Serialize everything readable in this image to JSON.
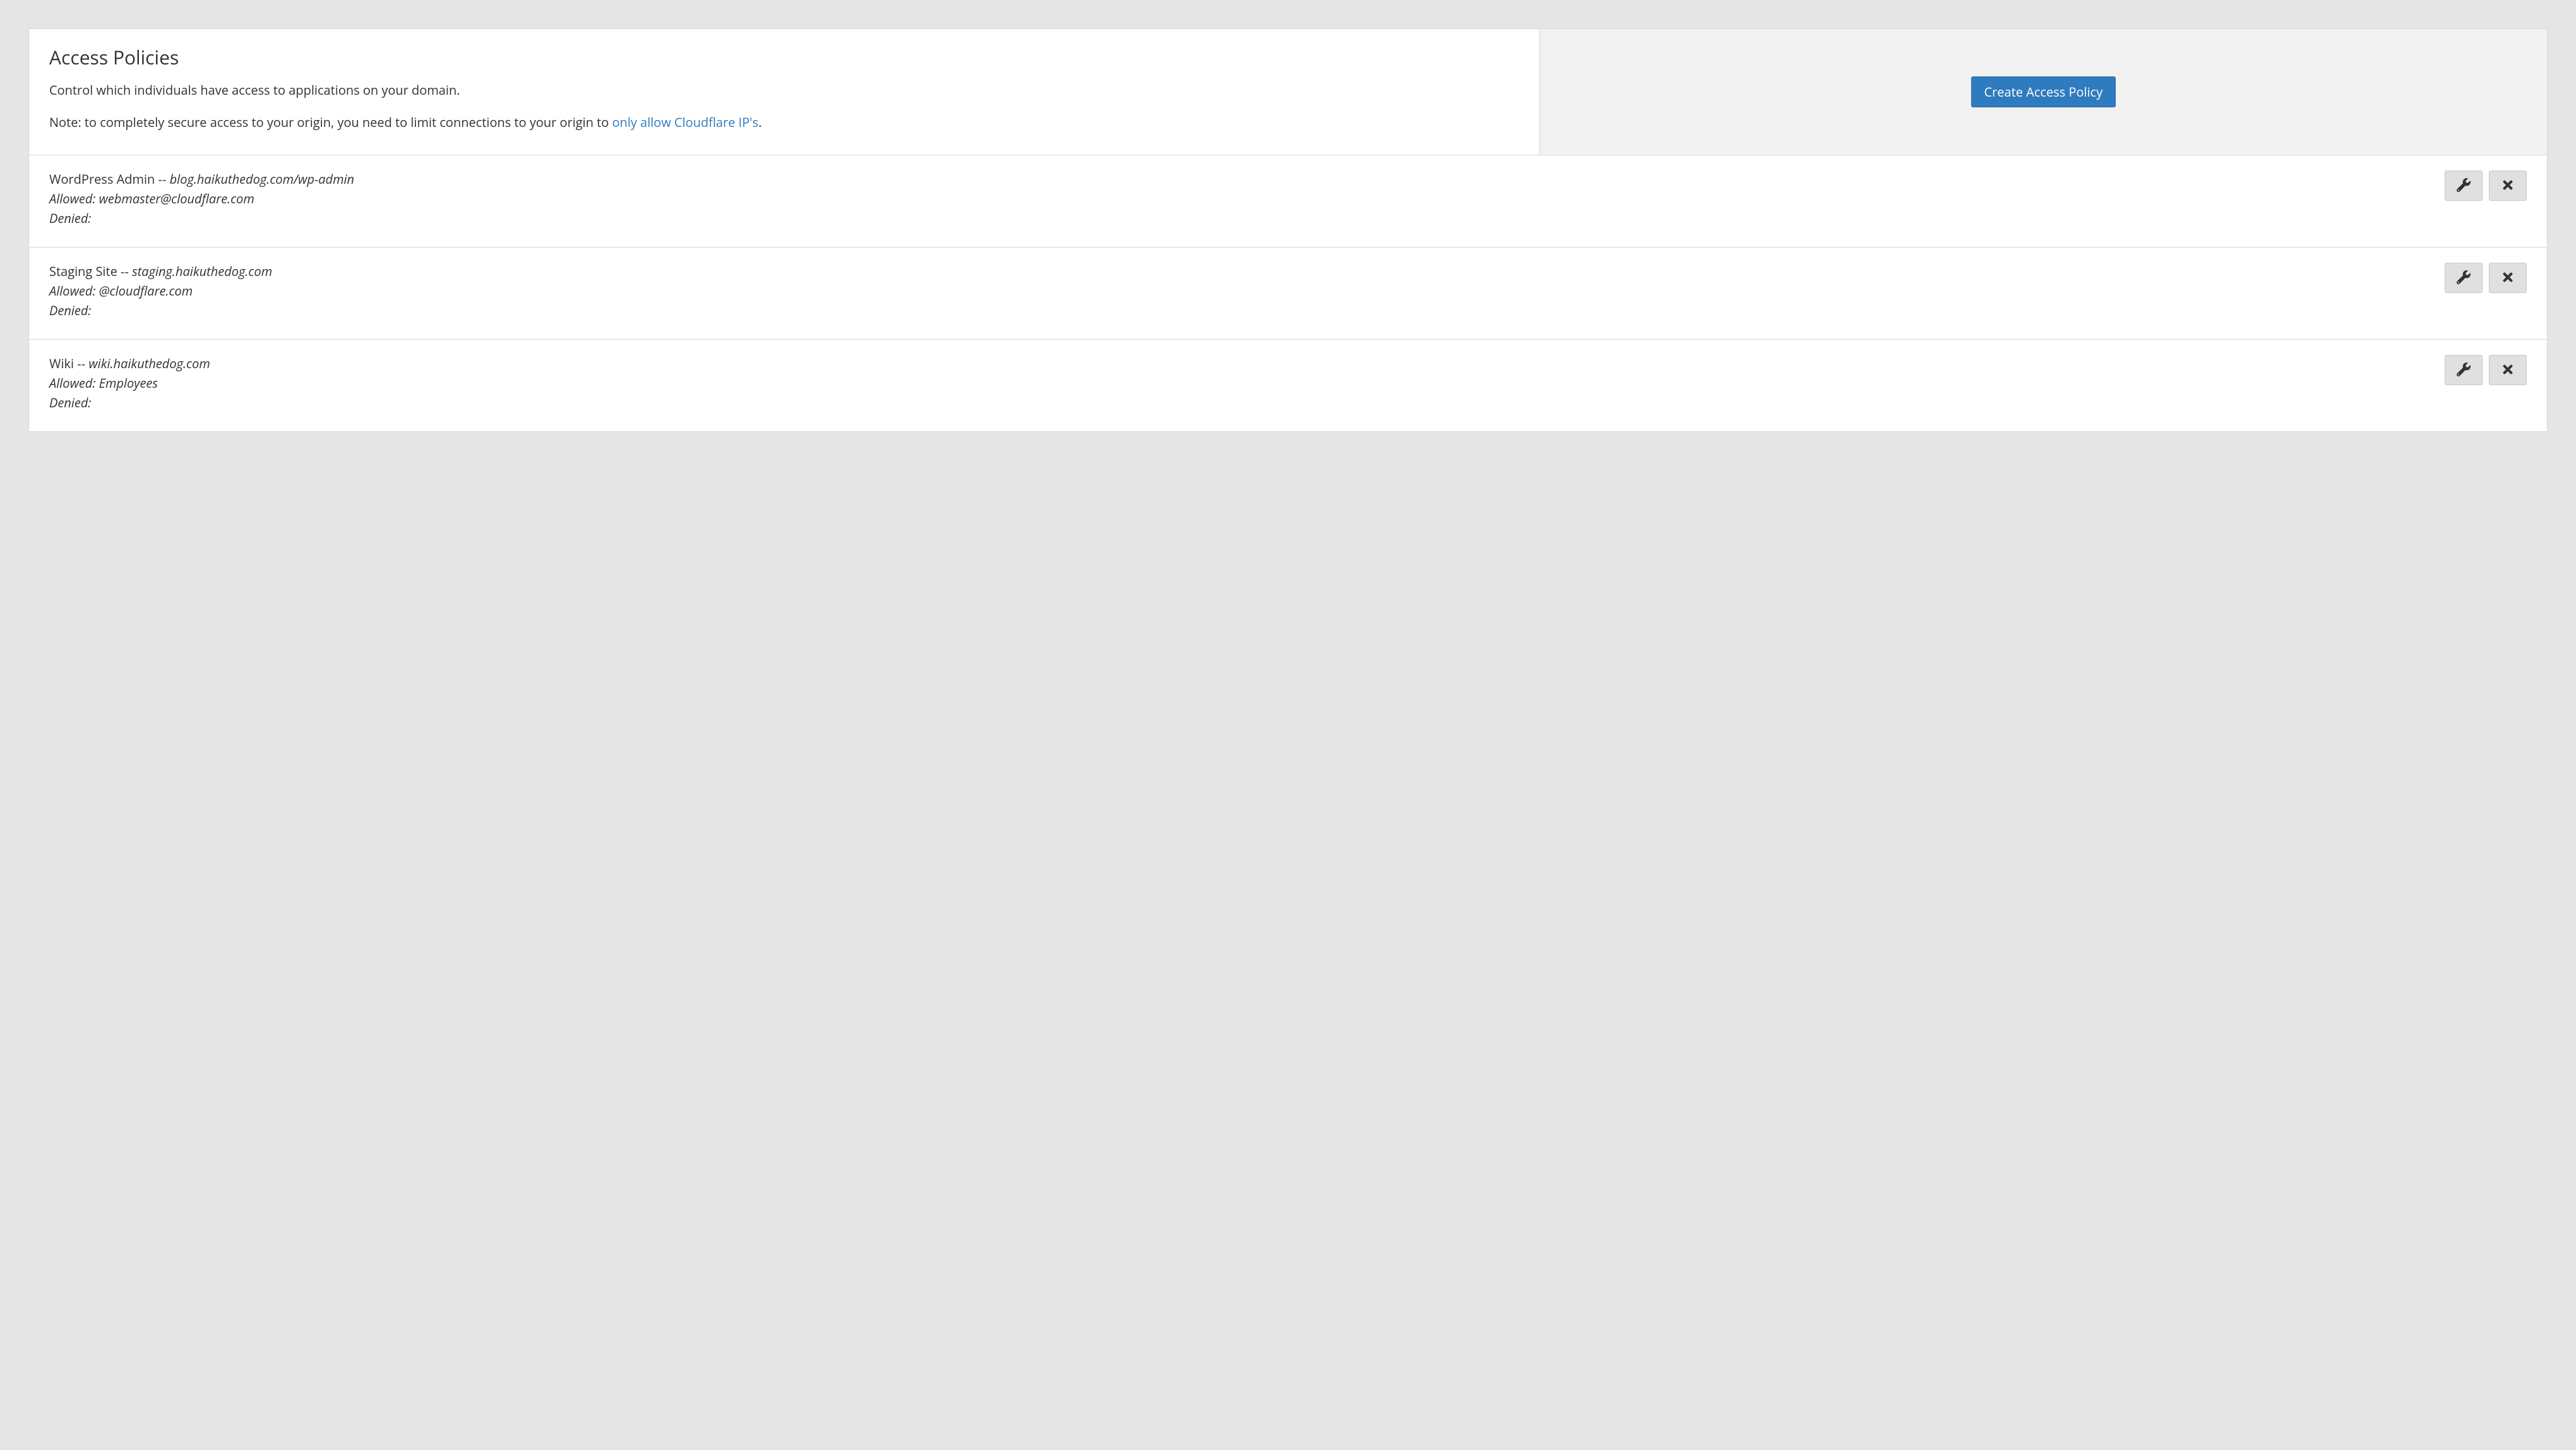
{
  "header": {
    "title": "Access Policies",
    "description": "Control which individuals have access to applications on your domain.",
    "note_prefix": "Note: to completely secure access to your origin, you need to limit connections to your origin to ",
    "note_link": "only allow Cloudflare IP's",
    "note_suffix": ".",
    "create_button": "Create Access Policy"
  },
  "labels": {
    "allowed": "Allowed: ",
    "denied": "Denied:",
    "separator": " -- "
  },
  "policies": [
    {
      "name": "WordPress Admin",
      "path": "blog.haikuthedog.com/wp-admin",
      "allowed": "webmaster@cloudflare.com",
      "denied": ""
    },
    {
      "name": "Staging Site",
      "path": "staging.haikuthedog.com",
      "allowed": "@cloudflare.com",
      "denied": ""
    },
    {
      "name": "Wiki",
      "path": "wiki.haikuthedog.com",
      "allowed": "Employees",
      "denied": ""
    }
  ]
}
